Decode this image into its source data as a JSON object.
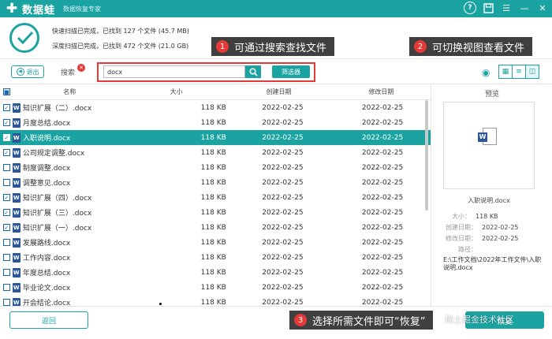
{
  "app": {
    "logo_text": "数据蛙",
    "subtitle": "数据恢复专家"
  },
  "status": {
    "quick_scan": "快速扫描已完成，已找到 127 个文件 (45.7 MB)",
    "deep_scan": "深度扫描已完成，已找到 472 个文件 (21.0 GB)"
  },
  "callouts": [
    {
      "num": "1",
      "text": "可通过搜索查找文件"
    },
    {
      "num": "2",
      "text": "可切换视图查看文件"
    },
    {
      "num": "3",
      "text": "选择所需文件即可“恢复”"
    }
  ],
  "toolbar": {
    "back_label": "退出",
    "search_label": "搜索",
    "search_value": "docx",
    "filter_label": "筛选器"
  },
  "table": {
    "headers": [
      "名称",
      "大小",
      "创建日期",
      "修改日期"
    ],
    "rows": [
      {
        "name": "知识扩展（二）.docx",
        "size": "118 KB",
        "created": "2022-02-25",
        "modified": "2022-02-25",
        "checked": true,
        "selected": false
      },
      {
        "name": "月度总结.docx",
        "size": "118 KB",
        "created": "2022-02-25",
        "modified": "2022-02-25",
        "checked": true,
        "selected": false
      },
      {
        "name": "入职说明.docx",
        "size": "118 KB",
        "created": "2022-02-25",
        "modified": "2022-02-25",
        "checked": true,
        "selected": true
      },
      {
        "name": "公司规定调整.docx",
        "size": "118 KB",
        "created": "2022-02-25",
        "modified": "2022-02-25",
        "checked": true,
        "selected": false
      },
      {
        "name": "制度调整.docx",
        "size": "118 KB",
        "created": "2022-02-25",
        "modified": "2022-02-25",
        "checked": false,
        "selected": false
      },
      {
        "name": "调整意见.docx",
        "size": "118 KB",
        "created": "2022-02-25",
        "modified": "2022-02-25",
        "checked": false,
        "selected": false
      },
      {
        "name": "知识扩展（四）.docx",
        "size": "118 KB",
        "created": "2022-02-25",
        "modified": "2022-02-25",
        "checked": true,
        "selected": false
      },
      {
        "name": "知识扩展（三）.docx",
        "size": "118 KB",
        "created": "2022-02-25",
        "modified": "2022-02-25",
        "checked": true,
        "selected": false
      },
      {
        "name": "知识扩展（一）.docx",
        "size": "118 KB",
        "created": "2022-02-25",
        "modified": "2022-02-25",
        "checked": true,
        "selected": false
      },
      {
        "name": "发展路线.docx",
        "size": "118 KB",
        "created": "2022-02-25",
        "modified": "2022-02-25",
        "checked": false,
        "selected": false
      },
      {
        "name": "工作内容.docx",
        "size": "118 KB",
        "created": "2022-02-25",
        "modified": "2022-02-25",
        "checked": false,
        "selected": false
      },
      {
        "name": "年度总结.docx",
        "size": "118 KB",
        "created": "2022-02-25",
        "modified": "2022-02-25",
        "checked": false,
        "selected": false
      },
      {
        "name": "毕业论文.docx",
        "size": "118 KB",
        "created": "2022-02-25",
        "modified": "2022-02-25",
        "checked": false,
        "selected": false
      },
      {
        "name": "开会结论.docx",
        "size": "118 KB",
        "created": "2022-02-25",
        "modified": "2022-02-25",
        "checked": false,
        "selected": false
      }
    ]
  },
  "preview": {
    "title": "预览",
    "file_name": "入职说明.docx",
    "size_label": "大小：",
    "size_value": "118 KB",
    "created_label": "创建日期：",
    "created_value": "2022-02-25",
    "modified_label": "修改日期：",
    "modified_value": "2022-02-25",
    "path_label": "路径：",
    "path_value": "E:\\工作文档\\2022年工作文件\\入职说明.docx"
  },
  "footer": {
    "return_label": "返回",
    "recover_label": "恢复",
    "watermark": "稀土掘金技术社区"
  },
  "colors": {
    "accent": "#1ba3a2",
    "callout_bg": "#3f3f3f",
    "callout_num": "#e53935"
  }
}
